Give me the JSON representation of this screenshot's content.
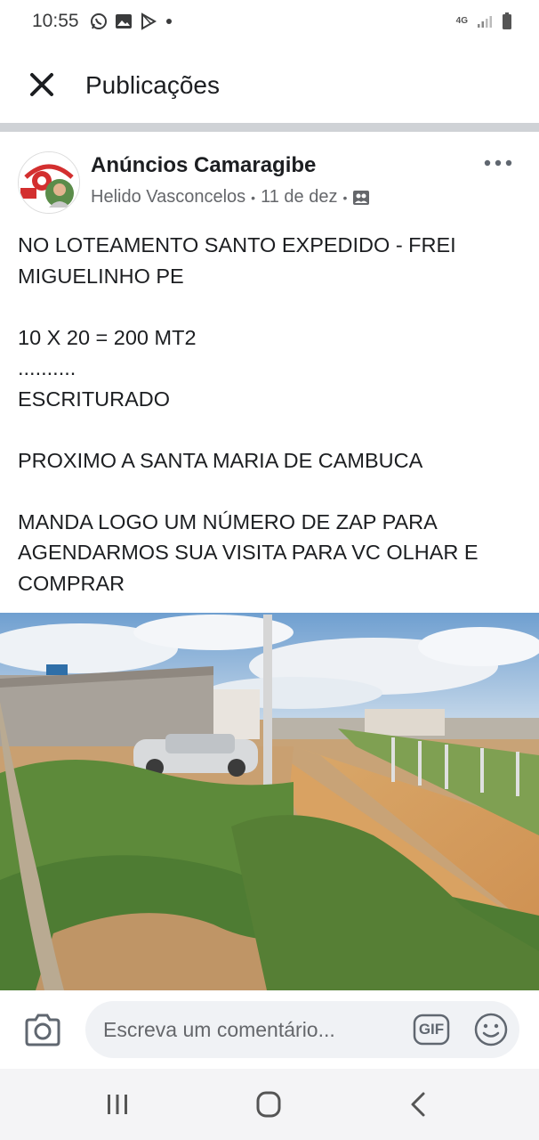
{
  "status_bar": {
    "time": "10:55",
    "network": "4G"
  },
  "header": {
    "title": "Publicações"
  },
  "post": {
    "group_name": "Anúncios Camaragibe",
    "author": "Helido Vasconcelos",
    "separator": "•",
    "date": "11 de dez",
    "text": "NO LOTEAMENTO SANTO EXPEDIDO - FREI MIGUELINHO PE\n\n10 X 20 = 200 MT2\n..........\nESCRITURADO\n\nPROXIMO A SANTA MARIA DE CAMBUCA\n\nMANDA LOGO UM NÚMERO DE ZAP PARA AGENDARMOS SUA VISITA PARA VC OLHAR E COMPRAR"
  },
  "comment_bar": {
    "placeholder": "Escreva um comentário...",
    "gif_label": "GIF"
  },
  "colors": {
    "divider": "#cfd2d6",
    "text_primary": "#1c1e21",
    "text_secondary": "#65676b",
    "input_bg": "#f0f2f5"
  }
}
